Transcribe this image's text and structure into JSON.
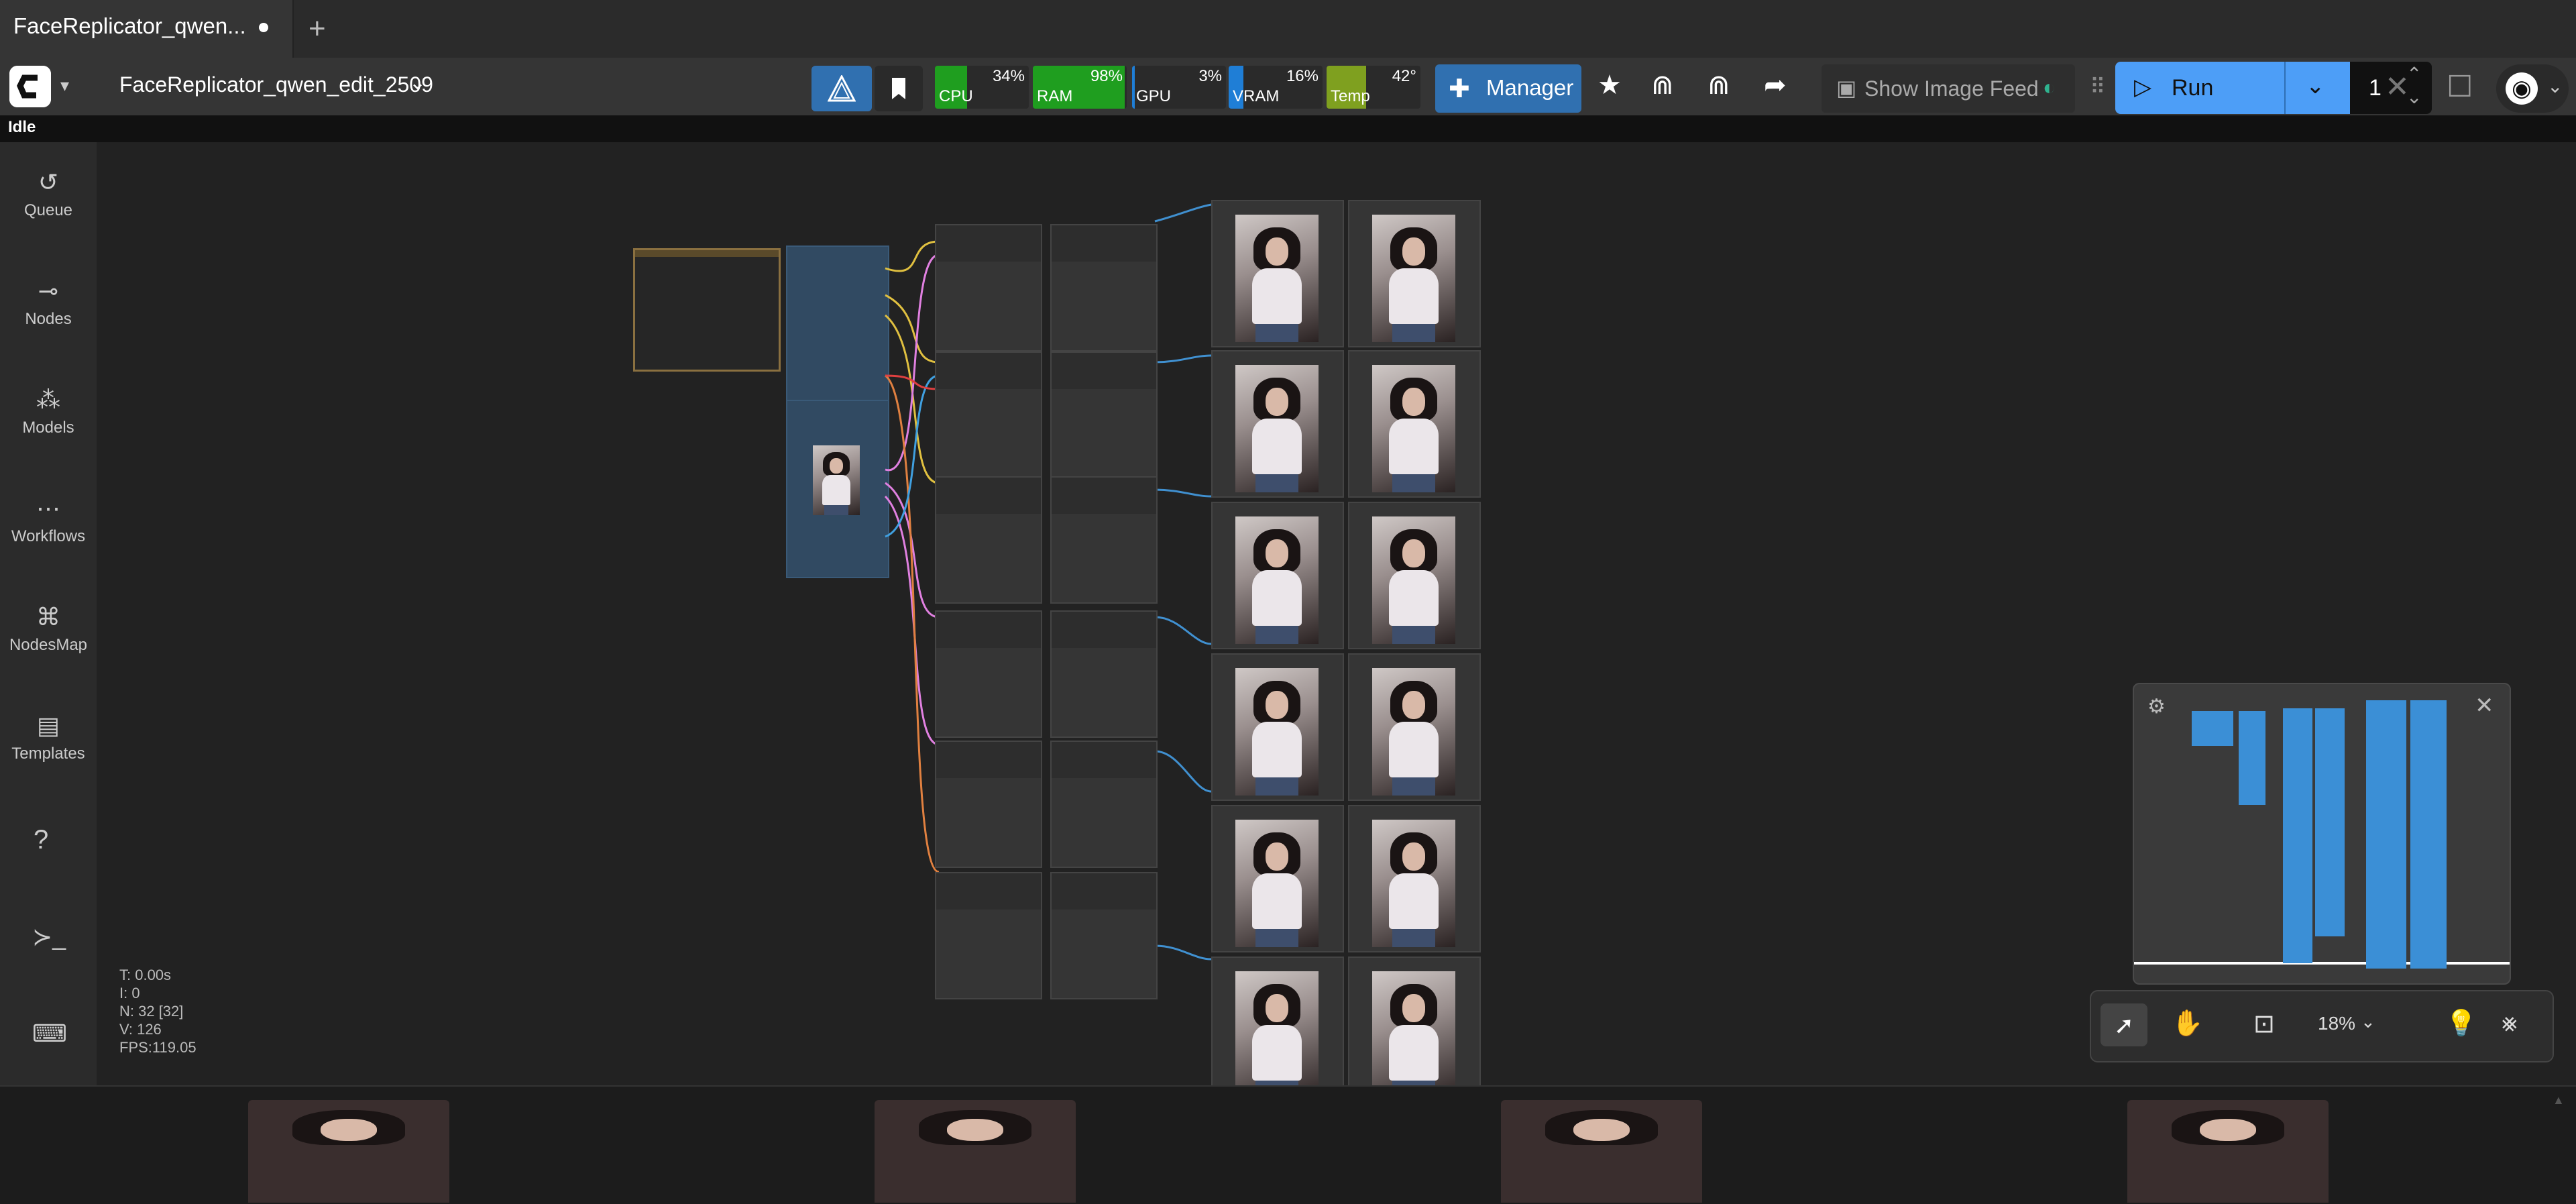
{
  "tab": {
    "title": "FaceReplicator_qwen...",
    "new_tab_icon": "plus-icon"
  },
  "topbar": {
    "workflow_name": "FaceReplicator_qwen_edit_2509",
    "monitors": [
      {
        "label": "CPU",
        "value": "34%",
        "fraction": 0.34,
        "color": "#1f9e1f"
      },
      {
        "label": "RAM",
        "value": "98%",
        "fraction": 0.98,
        "color": "#1f9e1f"
      },
      {
        "label": "GPU",
        "value": "3%",
        "fraction": 0.03,
        "color": "#1f7ed6"
      },
      {
        "label": "VRAM",
        "value": "16%",
        "fraction": 0.16,
        "color": "#1f7ed6"
      },
      {
        "label": "Temp",
        "value": "42°",
        "fraction": 0.42,
        "color": "#7fa01f"
      }
    ],
    "manager_label": "Manager",
    "show_image_feed_label": "Show Image Feed",
    "run_label": "Run",
    "batch_count": "1",
    "accent_color": "#4d9ef7"
  },
  "status": {
    "text": "Idle"
  },
  "sidebar": {
    "items": [
      {
        "label": "Queue",
        "icon": "history-icon"
      },
      {
        "label": "Nodes",
        "icon": "node-icon"
      },
      {
        "label": "Models",
        "icon": "models-icon"
      },
      {
        "label": "Workflows",
        "icon": "workflows-icon"
      },
      {
        "label": "NodesMap",
        "icon": "nodes-map-icon"
      },
      {
        "label": "Templates",
        "icon": "templates-icon"
      }
    ],
    "bottom_icons": [
      "help-icon",
      "terminal-icon",
      "keyboard-icon"
    ]
  },
  "stats": {
    "t": "T: 0.00s",
    "i": "I: 0",
    "n": "N: 32 [32]",
    "v": "V: 126",
    "fps": "FPS:119.05"
  },
  "canvas_toolbar": {
    "zoom": "18%"
  }
}
